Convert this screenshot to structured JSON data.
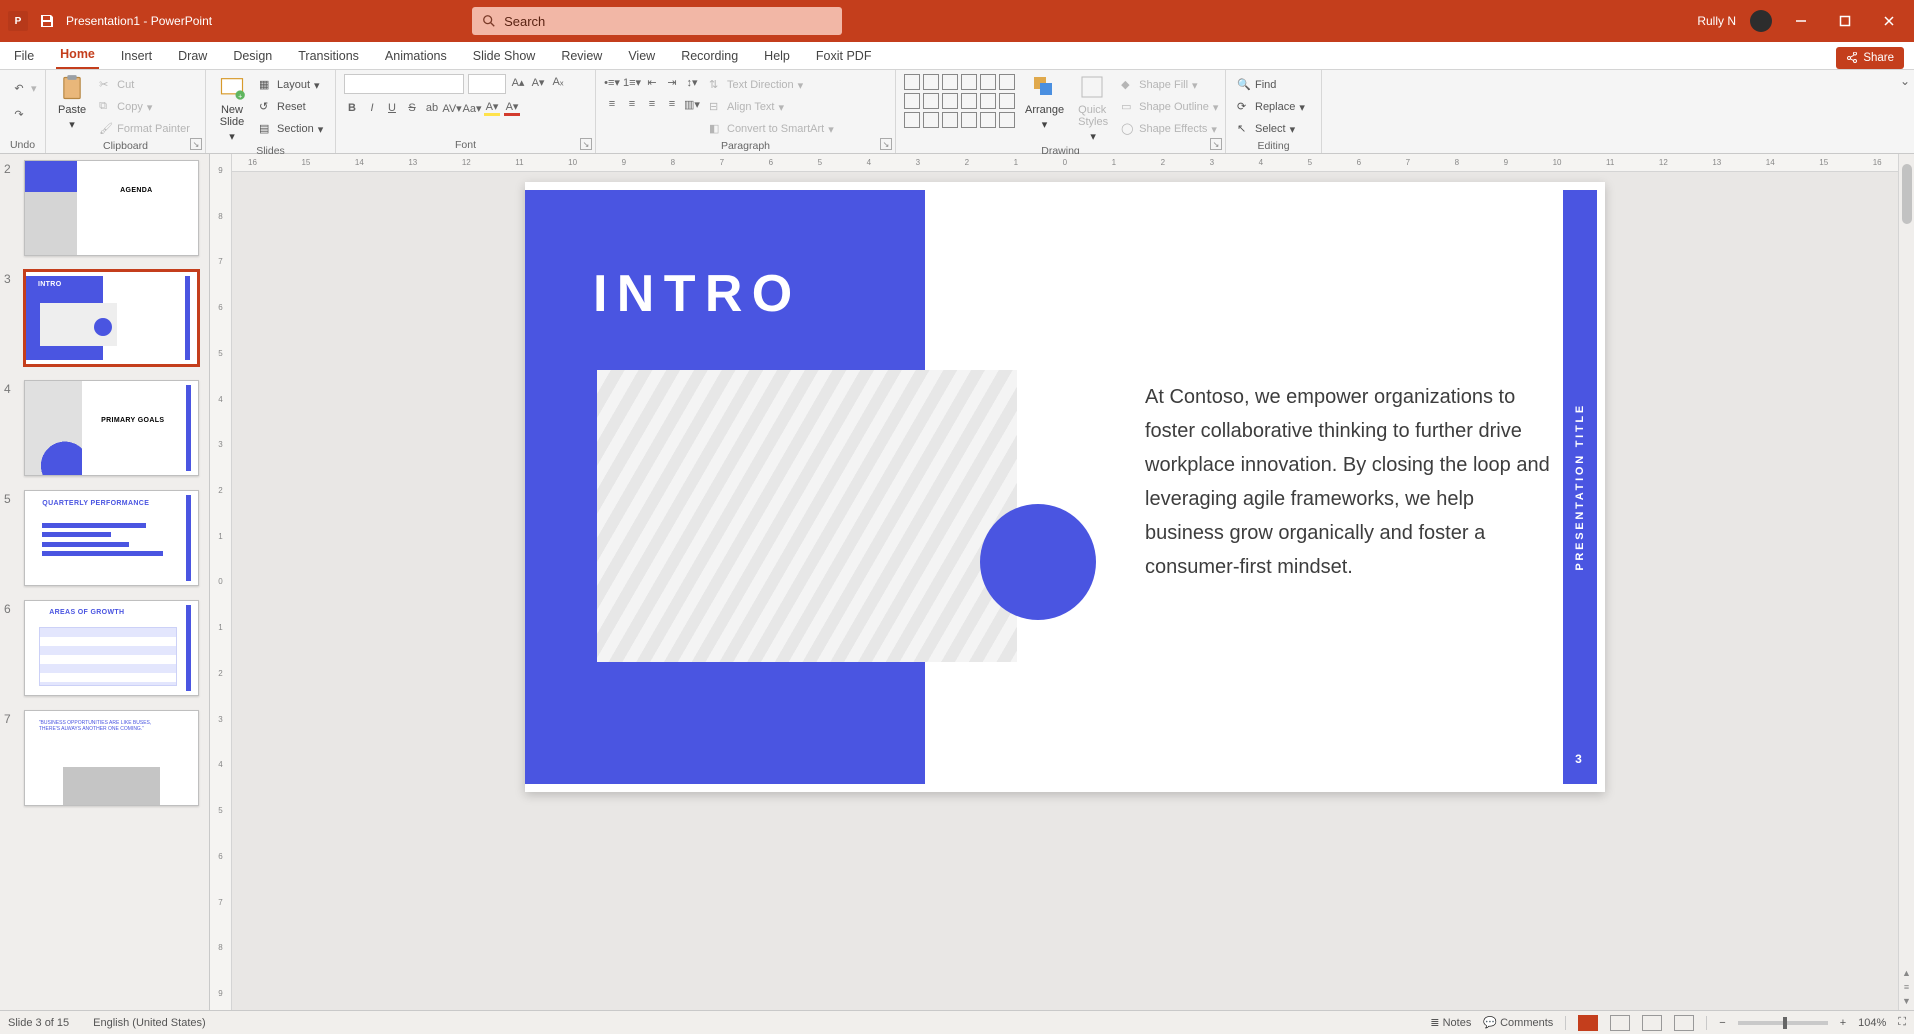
{
  "title_bar": {
    "app_badge": "P",
    "doc_title": "Presentation1  -  PowerPoint",
    "search_placeholder": "Search",
    "user_name": "Rully N"
  },
  "tabs": {
    "items": [
      "File",
      "Home",
      "Insert",
      "Draw",
      "Design",
      "Transitions",
      "Animations",
      "Slide Show",
      "Review",
      "View",
      "Recording",
      "Help",
      "Foxit PDF"
    ],
    "active_index": 1,
    "share_label": "Share"
  },
  "ribbon": {
    "undo": {
      "title": "Undo"
    },
    "clipboard": {
      "title": "Clipboard",
      "paste": "Paste",
      "cut": "Cut",
      "copy": "Copy",
      "format_painter": "Format Painter"
    },
    "slides": {
      "title": "Slides",
      "new_slide": "New\nSlide",
      "layout": "Layout",
      "reset": "Reset",
      "section": "Section"
    },
    "font": {
      "title": "Font"
    },
    "paragraph": {
      "title": "Paragraph",
      "text_direction": "Text Direction",
      "align_text": "Align Text",
      "convert_smartart": "Convert to SmartArt"
    },
    "drawing": {
      "title": "Drawing",
      "arrange": "Arrange",
      "quick_styles": "Quick\nStyles",
      "shape_fill": "Shape Fill",
      "shape_outline": "Shape Outline",
      "shape_effects": "Shape Effects"
    },
    "editing": {
      "title": "Editing",
      "find": "Find",
      "replace": "Replace",
      "select": "Select"
    }
  },
  "ruler_h": [
    "16",
    "15",
    "14",
    "13",
    "12",
    "11",
    "10",
    "9",
    "8",
    "7",
    "6",
    "5",
    "4",
    "3",
    "2",
    "1",
    "0",
    "1",
    "2",
    "3",
    "4",
    "5",
    "6",
    "7",
    "8",
    "9",
    "10",
    "11",
    "12",
    "13",
    "14",
    "15",
    "16"
  ],
  "ruler_v": [
    "9",
    "8",
    "7",
    "6",
    "5",
    "4",
    "3",
    "2",
    "1",
    "0",
    "1",
    "2",
    "3",
    "4",
    "5",
    "6",
    "7",
    "8",
    "9"
  ],
  "thumbnails": [
    {
      "num": "2",
      "title": "AGENDA",
      "active": false
    },
    {
      "num": "3",
      "title": "INTRO",
      "active": true
    },
    {
      "num": "4",
      "title": "PRIMARY GOALS",
      "active": false
    },
    {
      "num": "5",
      "title": "QUARTERLY PERFORMANCE",
      "active": false
    },
    {
      "num": "6",
      "title": "AREAS OF GROWTH",
      "active": false
    },
    {
      "num": "7",
      "title": "",
      "active": false
    }
  ],
  "slide": {
    "title": "INTRO",
    "body": "At Contoso, we empower organizations to foster collaborative thinking to further drive workplace innovation. By closing the loop and leveraging agile frameworks, we help business grow organically and foster a consumer-first mindset.",
    "sidebar_label": "PRESENTATION TITLE",
    "page_number": "3"
  },
  "status": {
    "slide_info": "Slide 3 of 15",
    "language": "English (United States)",
    "notes": "Notes",
    "comments": "Comments",
    "zoom": "104%"
  }
}
